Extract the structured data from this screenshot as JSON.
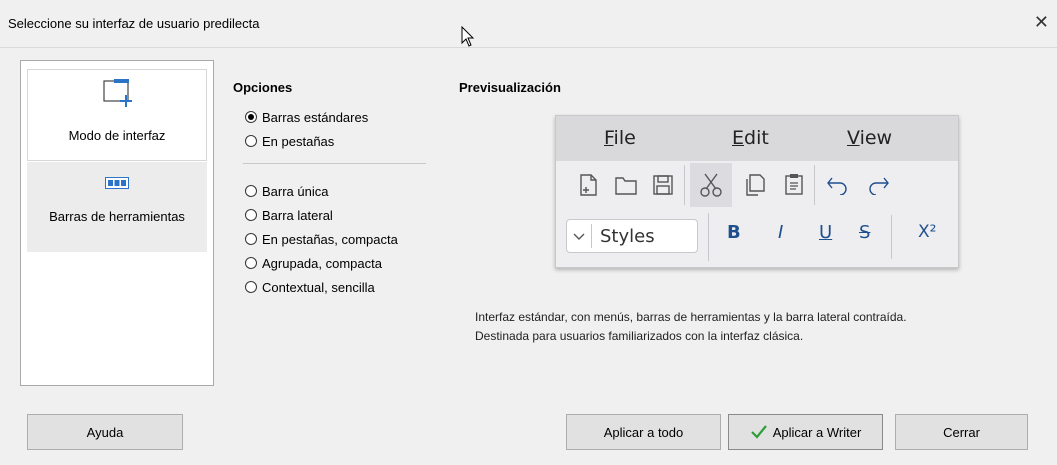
{
  "window": {
    "title": "Seleccione su interfaz de usuario predilecta",
    "close_glyph": "✕"
  },
  "left_panel": {
    "items": [
      {
        "label": "Modo de interfaz",
        "icon": "interface-mode-icon",
        "selected": true
      },
      {
        "label": "Barras de herramientas",
        "icon": "toolbars-icon",
        "selected": false
      }
    ]
  },
  "options": {
    "title": "Opciones",
    "group1": [
      {
        "label": "Barras estándares",
        "checked": true
      },
      {
        "label": "En pestañas",
        "checked": false
      }
    ],
    "group2": [
      {
        "label": "Barra única",
        "checked": false
      },
      {
        "label": "Barra lateral",
        "checked": false
      },
      {
        "label": "En pestañas, compacta",
        "checked": false
      },
      {
        "label": "Agrupada, compacta",
        "checked": false
      },
      {
        "label": "Contextual, sencilla",
        "checked": false
      }
    ]
  },
  "preview": {
    "title": "Previsualización",
    "menu": [
      {
        "accel": "F",
        "rest": "ile"
      },
      {
        "accel": "E",
        "rest": "dit"
      },
      {
        "accel": "V",
        "rest": "iew"
      }
    ],
    "styles_label": "Styles",
    "format_buttons": [
      "B",
      "I",
      "U",
      "S",
      "X²"
    ],
    "accent_color": "#1f4f8f"
  },
  "description": {
    "line1": "Interfaz estándar, con menús, barras de herramientas y la barra lateral contraída.",
    "line2": "Destinada para usuarios familiarizados con la interfaz clásica."
  },
  "buttons": {
    "help": "Ayuda",
    "apply_all": "Aplicar a todo",
    "apply_writer": "Aplicar a Writer",
    "close": "Cerrar",
    "check_color": "#2e9e3a"
  }
}
